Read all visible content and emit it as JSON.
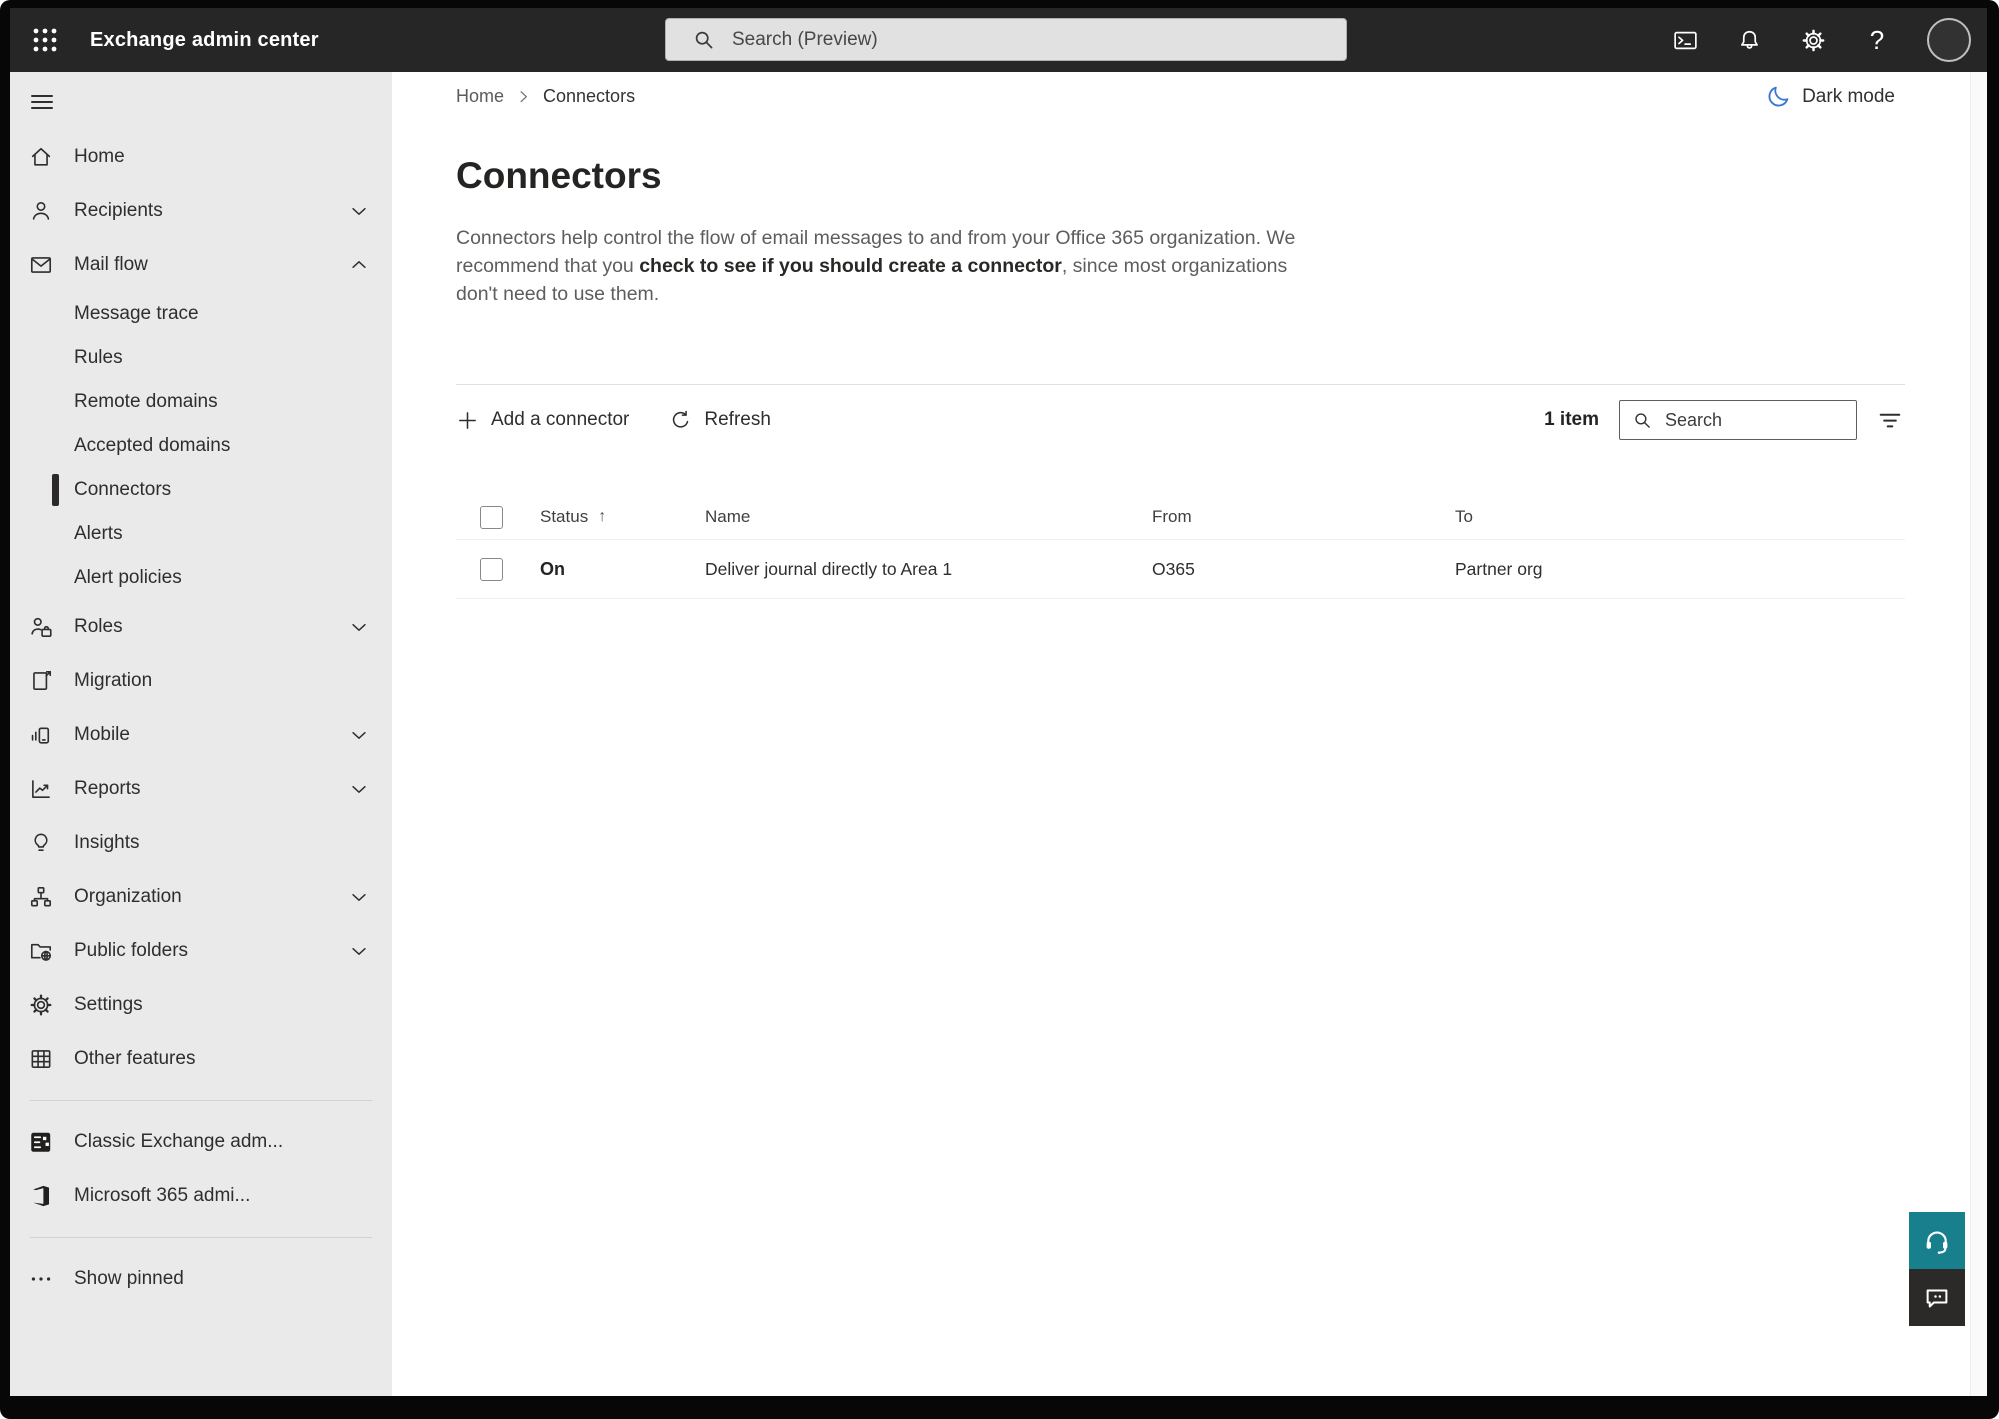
{
  "topbar": {
    "title": "Exchange admin center",
    "search_placeholder": "Search (Preview)",
    "icons": [
      "app-launcher",
      "terminal",
      "notifications",
      "settings",
      "help",
      "account"
    ]
  },
  "breadcrumb": {
    "items": [
      "Home",
      "Connectors"
    ]
  },
  "theme_toggle": {
    "label": "Dark mode"
  },
  "page": {
    "title": "Connectors",
    "description": {
      "pre": "Connectors help control the flow of email messages to and from your Office 365 organization. We recommend that you ",
      "link": "check to see if you should create a connector",
      "post": ", since most organizations don't need to use them."
    }
  },
  "toolbar": {
    "add": "Add a connector",
    "refresh": "Refresh",
    "count": "1 item",
    "search_placeholder": "Search",
    "sort_arrow": "↑"
  },
  "table": {
    "columns": [
      "Status",
      "Name",
      "From",
      "To"
    ],
    "rows": [
      {
        "status": "On",
        "name": "Deliver journal directly to Area 1",
        "from": "O365",
        "to": "Partner org"
      }
    ]
  },
  "sidebar": {
    "items": [
      {
        "label": "Home",
        "icon": "home",
        "type": "top"
      },
      {
        "label": "Recipients",
        "icon": "person",
        "type": "top",
        "chevron": "down"
      },
      {
        "label": "Mail flow",
        "icon": "mail",
        "type": "top",
        "chevron": "up"
      },
      {
        "label": "Message trace",
        "type": "sub"
      },
      {
        "label": "Rules",
        "type": "sub"
      },
      {
        "label": "Remote domains",
        "type": "sub"
      },
      {
        "label": "Accepted domains",
        "type": "sub"
      },
      {
        "label": "Connectors",
        "type": "sub",
        "selected": true
      },
      {
        "label": "Alerts",
        "type": "sub"
      },
      {
        "label": "Alert policies",
        "type": "sub"
      },
      {
        "label": "Roles",
        "icon": "roles",
        "type": "top",
        "chevron": "down"
      },
      {
        "label": "Migration",
        "icon": "migration",
        "type": "top"
      },
      {
        "label": "Mobile",
        "icon": "mobile",
        "type": "top",
        "chevron": "down"
      },
      {
        "label": "Reports",
        "icon": "reports",
        "type": "top",
        "chevron": "down"
      },
      {
        "label": "Insights",
        "icon": "insights",
        "type": "top"
      },
      {
        "label": "Organization",
        "icon": "organization",
        "type": "top",
        "chevron": "down"
      },
      {
        "label": "Public folders",
        "icon": "public-folders",
        "type": "top",
        "chevron": "down"
      },
      {
        "label": "Settings",
        "icon": "settings",
        "type": "top"
      },
      {
        "label": "Other features",
        "icon": "other-features",
        "type": "top"
      },
      {
        "divider": true
      },
      {
        "label": "Classic Exchange adm...",
        "icon": "classic-exchange",
        "type": "top"
      },
      {
        "label": "Microsoft 365 admi...",
        "icon": "microsoft-365",
        "type": "top"
      },
      {
        "divider": true
      },
      {
        "label": "Show pinned",
        "icon": "ellipsis",
        "type": "top"
      }
    ]
  },
  "floating": {
    "buttons": [
      "support",
      "feedback"
    ]
  },
  "colors": {
    "accent_teal": "#17808c",
    "darkmode_blue": "#3b76d6",
    "topbar_bg": "#262626",
    "sidebar_bg": "#eaeaea",
    "selected_indicator": "#2b2a29"
  }
}
